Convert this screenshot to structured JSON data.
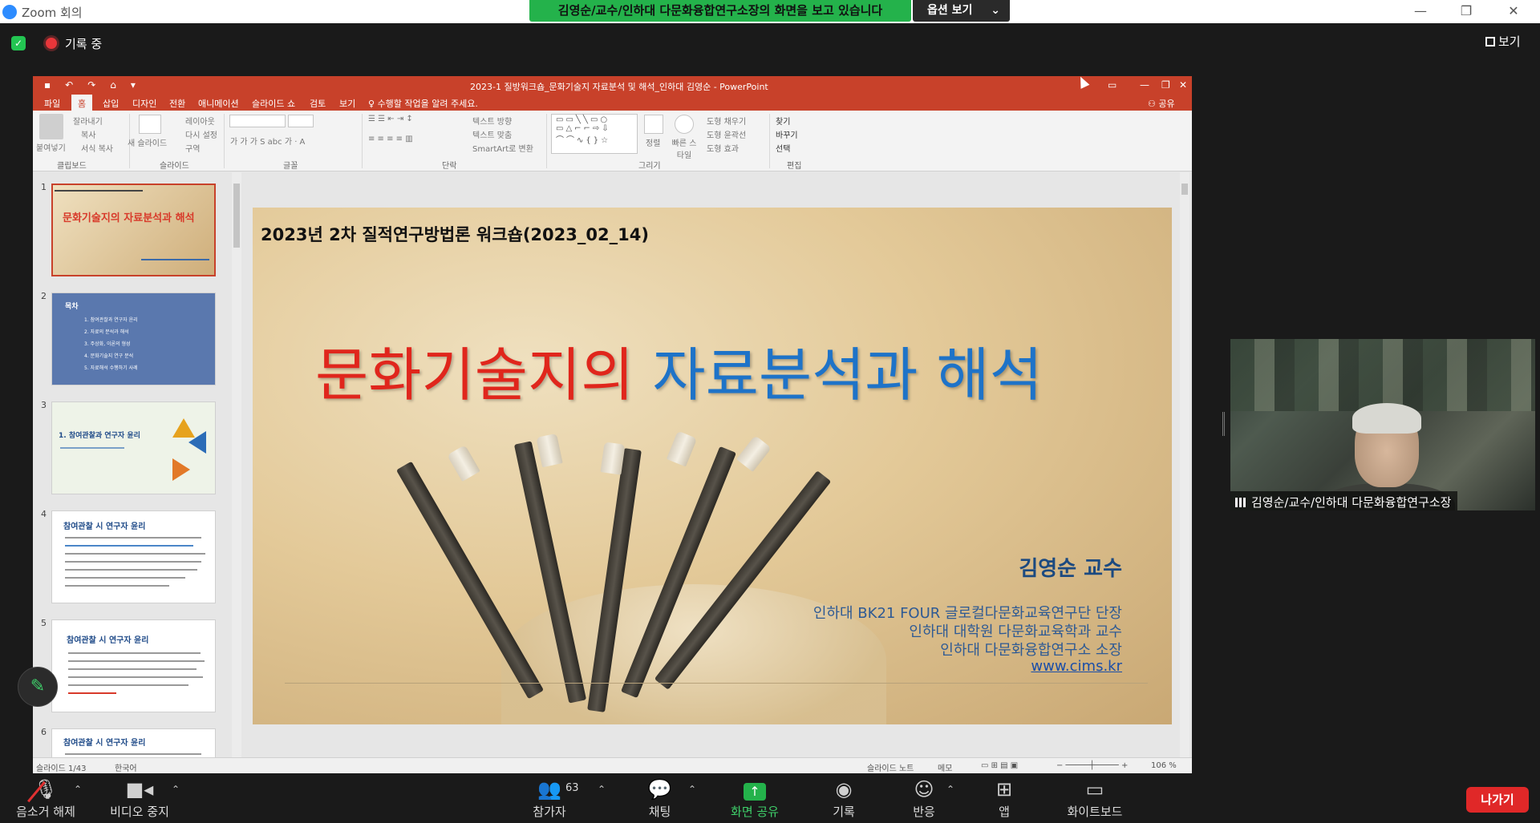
{
  "window": {
    "app_title": "Zoom 회의",
    "share_banner": "김영순/교수/인하대 다문화융합연구소장의 화면을 보고 있습니다",
    "options_label": "옵션 보기",
    "recording_label": "기록 중",
    "view_label": "보기"
  },
  "powerpoint": {
    "document_title": "2023-1 질방워크숍_문화기술지 자료분석 및 해석_인하대 김영순 - PowerPoint",
    "tabs": [
      "파일",
      "홈",
      "삽입",
      "디자인",
      "전환",
      "애니메이션",
      "슬라이드 쇼",
      "검토",
      "보기"
    ],
    "tell_me": "수행할 작업을 알려 주세요.",
    "share": "공유",
    "ribbon": {
      "clipboard": {
        "paste": "붙여넣기",
        "cut": "잘라내기",
        "copy": "복사",
        "format_painter": "서식 복사",
        "group": "클립보드"
      },
      "slides": {
        "new_slide": "새 슬라이드",
        "layout": "레이아웃",
        "reset": "다시 설정",
        "section": "구역",
        "group": "슬라이드"
      },
      "font": {
        "group": "글꼴"
      },
      "paragraph": {
        "text_direction": "텍스트 방향",
        "align_text": "텍스트 맞춤",
        "smartart": "SmartArt로 변환",
        "group": "단락"
      },
      "drawing": {
        "arrange": "정렬",
        "quick_styles": "빠른 스타일",
        "shape_fill": "도형 채우기",
        "shape_outline": "도형 윤곽선",
        "shape_effects": "도형 효과",
        "group": "그리기"
      },
      "editing": {
        "find": "찾기",
        "replace": "바꾸기",
        "select": "선택",
        "group": "편집"
      }
    },
    "thumbnails": [
      {
        "num": "1",
        "title": "문화기술지의 자료분석과 해석"
      },
      {
        "num": "2",
        "title": "목차",
        "items": [
          "1. 참여관찰과 연구자 윤리",
          "2. 자료의 분석과 해석",
          "3. 주상화, 이론의 형성",
          "4. 문화기술지 연구 분석",
          "5. 자료해석 수행하기 사례"
        ]
      },
      {
        "num": "3",
        "title": "1. 참여관찰과 연구자 윤리"
      },
      {
        "num": "4",
        "title": "참여관찰 시 연구자 윤리"
      },
      {
        "num": "5",
        "title": "참여관찰 시 연구자 윤리"
      },
      {
        "num": "6",
        "title": "참여관찰 시 연구자 윤리"
      }
    ],
    "slide": {
      "header": "2023년 2차 질적연구방법론 워크숍(2023_02_14)",
      "title_red": "문화기술지의",
      "title_blue": "자료분석과 해석",
      "author": "김영순 교수",
      "affiliations": [
        "인하대 BK21 FOUR 글로컬다문화교육연구단 단장",
        "인하대 대학원 다문화교육학과 교수",
        "인하대 다문화융합연구소 소장"
      ],
      "website": "www.cims.kr"
    },
    "status": {
      "slide_counter": "슬라이드 1/43",
      "language": "한국어",
      "notes": "슬라이드 노트",
      "comments": "메모",
      "zoom": "106 %"
    }
  },
  "video": {
    "participant_name": "김영순/교수/인하대 다문화융합연구소장"
  },
  "toolbar": {
    "unmute": "음소거 해제",
    "stop_video": "비디오 중지",
    "participants": "참가자",
    "participant_count": "63",
    "chat": "채팅",
    "share_screen": "화면 공유",
    "record": "기록",
    "reactions": "반응",
    "apps": "앱",
    "whiteboard": "화이트보드",
    "leave": "나가기"
  },
  "colors": {
    "ppt_accent": "#c8412a",
    "zoom_green": "#24b24b",
    "title_red": "#e0261c",
    "title_blue": "#1e73c8",
    "leave_red": "#e02828"
  }
}
